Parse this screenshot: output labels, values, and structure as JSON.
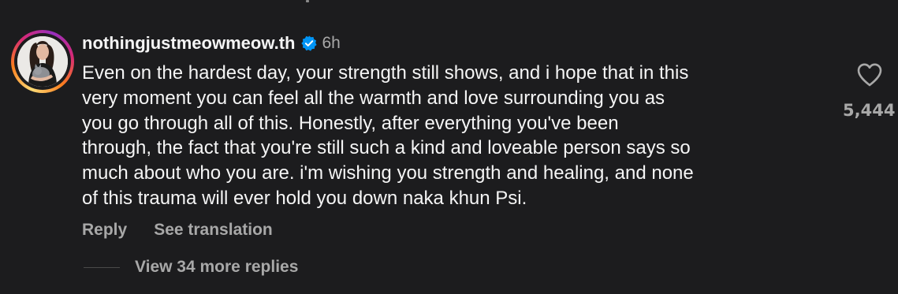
{
  "comment": {
    "username": "nothingjustmeowmeow.th",
    "verified_icon": "verified-badge-icon",
    "timestamp": "6h",
    "text": "Even on the hardest day, your strength still shows, and i hope that in this\nvery moment you can feel all the warmth and love surrounding you as\nyou go through all of this. Honestly, after everything you've been\nthrough, the fact that you're still such a kind and loveable person says so\nmuch about who you are. i'm wishing you strength and healing, and none\nof this trauma will ever hold you down naka khun Psi.",
    "like_count": "5,444",
    "like_icon": "heart-outline-icon"
  },
  "actions": {
    "reply_label": "Reply",
    "translate_label": "See translation"
  },
  "replies": {
    "label": "View 34 more replies"
  },
  "colors": {
    "background": "#1c1c1e",
    "text_primary": "#f5f5f5",
    "text_secondary": "#a8a8a8",
    "verified_blue": "#0095f6"
  }
}
